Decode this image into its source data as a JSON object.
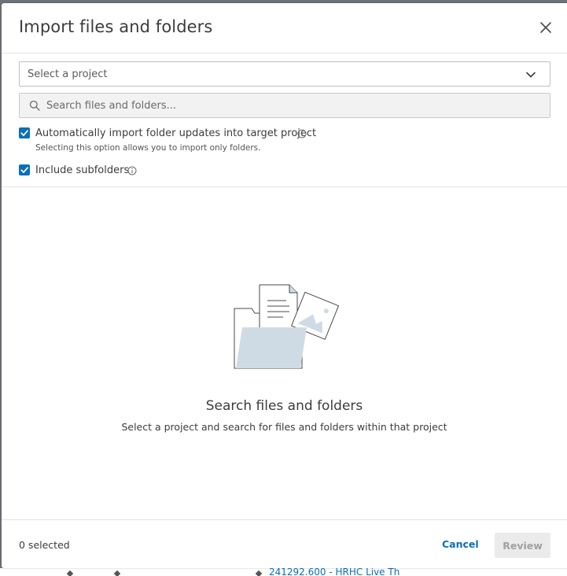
{
  "dialog": {
    "title": "Import files and folders",
    "close_icon": "close-icon"
  },
  "project_select": {
    "placeholder": "Select a project",
    "icon": "chevron-down-icon"
  },
  "search": {
    "placeholder": "Search files and folders...",
    "value": "",
    "icon": "search-icon"
  },
  "options": {
    "auto_import": {
      "label": "Automatically import folder updates into target project",
      "helper": "Selecting this option allows you to import only folders.",
      "checked": true
    },
    "include_subfolders": {
      "label": "Include subfolders",
      "checked": true
    }
  },
  "empty_state": {
    "illustration": "files-and-folder-illustration",
    "title": "Search files and folders",
    "subtitle": "Select a project and search for files and folders within that project"
  },
  "footer": {
    "selected_count": "0 selected",
    "cancel_label": "Cancel",
    "review_label": "Review"
  },
  "background": {
    "partial_text": "241292.600 - HRHC Live Th"
  },
  "colors": {
    "accent": "#0a6fb8",
    "illustration_fill": "#cfdbe4"
  }
}
